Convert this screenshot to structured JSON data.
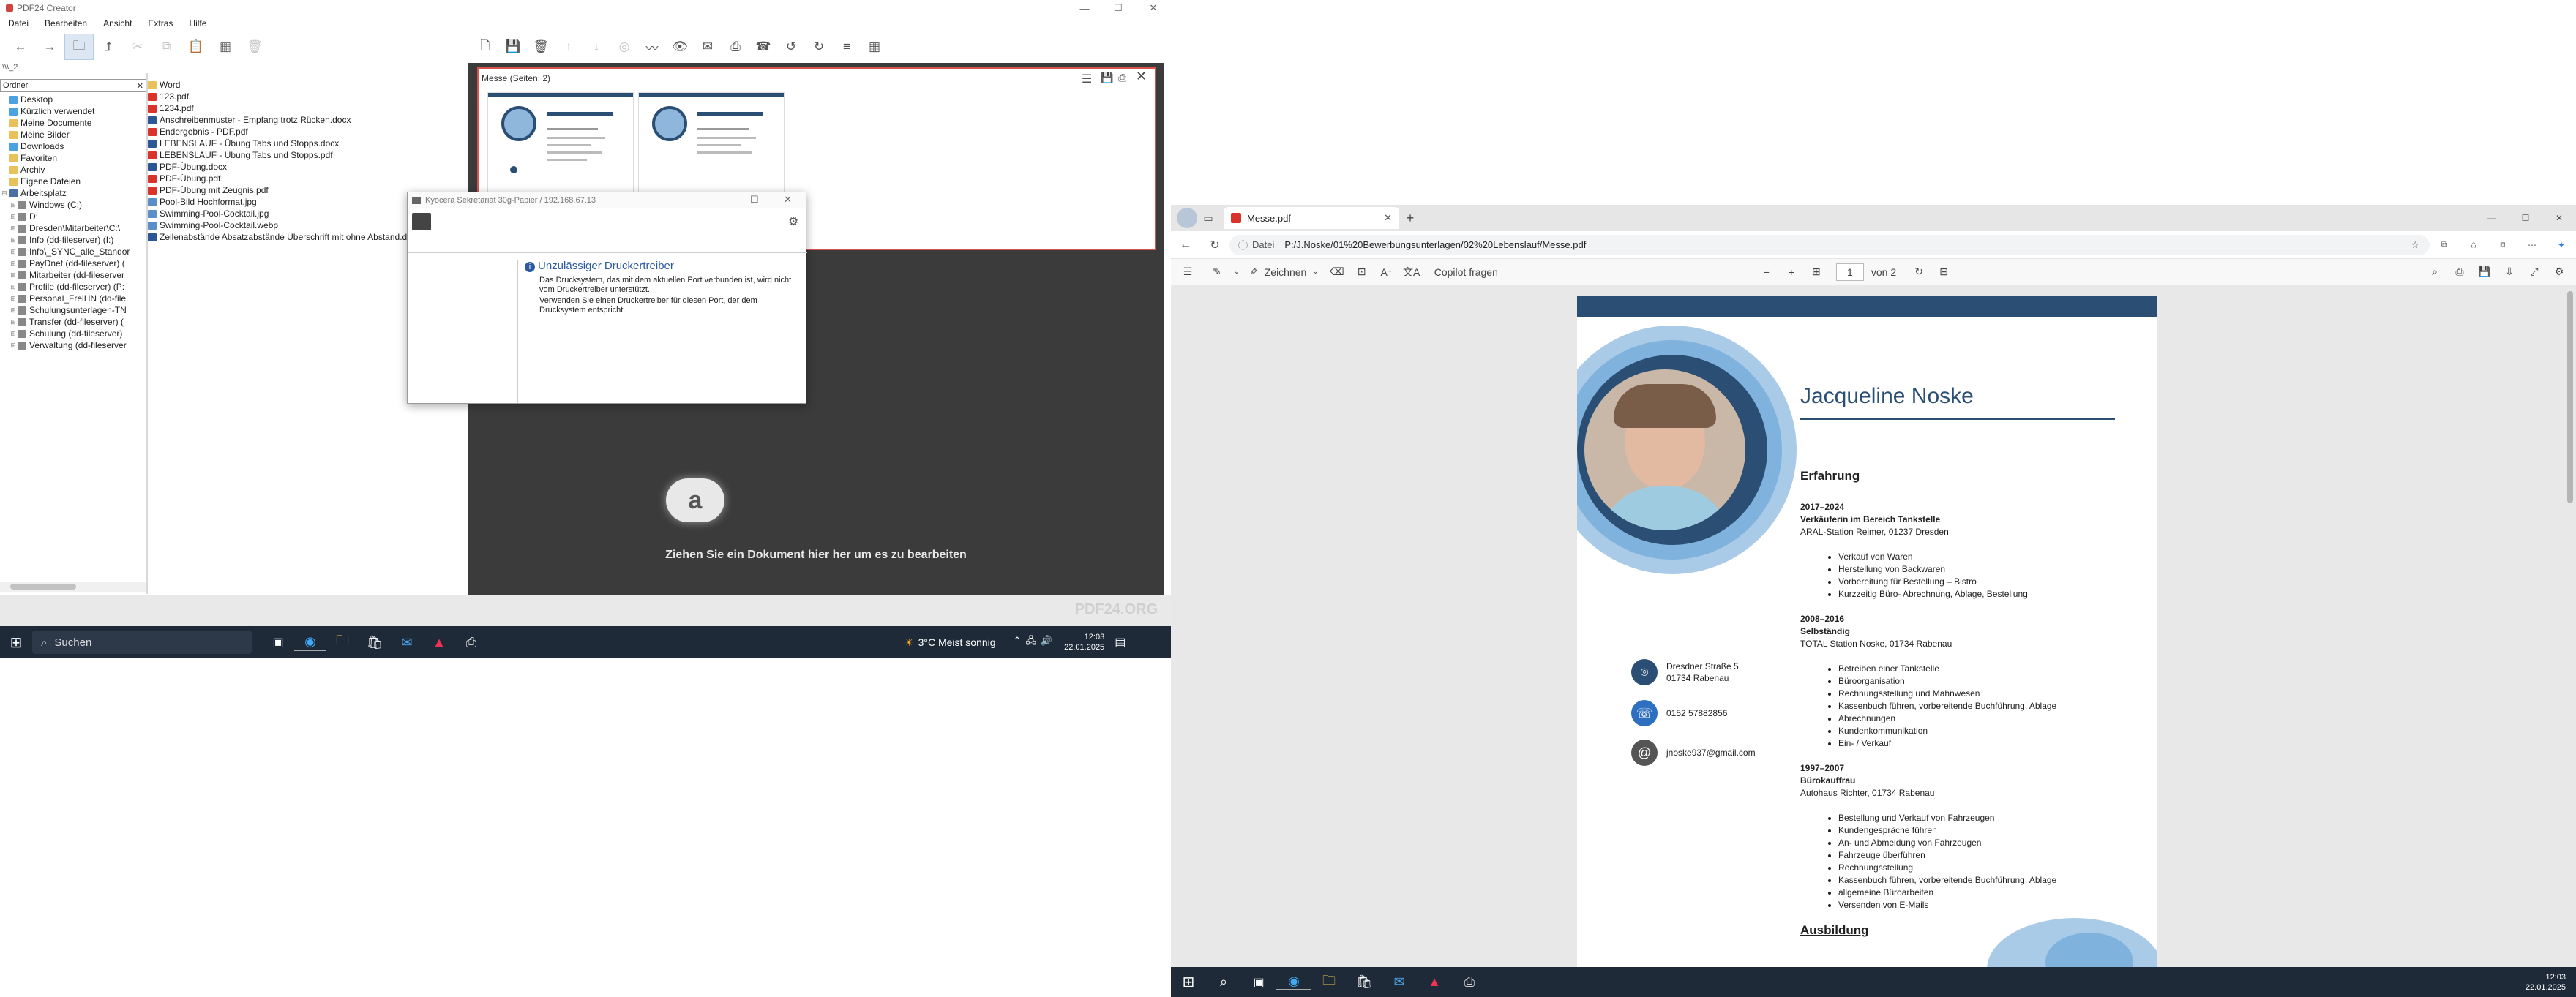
{
  "left_app": {
    "title": "PDF24 Creator",
    "menu": [
      "Datei",
      "Bearbeiten",
      "Ansicht",
      "Extras",
      "Hilfe"
    ],
    "path": "\\\\\\_2",
    "tree_header": "Ordner",
    "tree": [
      {
        "label": "Desktop",
        "color": "#4aa3df"
      },
      {
        "label": "Kürzlich verwendet",
        "color": "#4aa3df"
      },
      {
        "label": "Meine Documente",
        "color": "#e8c15a"
      },
      {
        "label": "Meine Bilder",
        "color": "#e8c15a"
      },
      {
        "label": "Downloads",
        "color": "#4aa3df"
      },
      {
        "label": "Favoriten",
        "color": "#e8c15a"
      },
      {
        "label": "Archiv",
        "color": "#e8c15a"
      },
      {
        "label": "Eigene Dateien",
        "color": "#e8c15a"
      },
      {
        "label": "Arbeitsplatz",
        "color": "#4a6fa5"
      },
      {
        "label": "Windows (C:)",
        "color": "#888"
      },
      {
        "label": "D:",
        "color": "#888"
      },
      {
        "label": "Dresden\\Mitarbeiter\\C:\\",
        "color": "#888"
      },
      {
        "label": "Info (dd-fileserver) (I:)",
        "color": "#888"
      },
      {
        "label": "Info\\_SYNC_alle_Standor",
        "color": "#888"
      },
      {
        "label": "PayDnet (dd-fileserver) (",
        "color": "#888"
      },
      {
        "label": "Mitarbeiter (dd-fileserver",
        "color": "#888"
      },
      {
        "label": "Profile (dd-fileserver) (P:",
        "color": "#888"
      },
      {
        "label": "Personal_FreiHN (dd-file",
        "color": "#888"
      },
      {
        "label": "Schulungsunterlagen-TN",
        "color": "#888"
      },
      {
        "label": "Transfer (dd-fileserver) (",
        "color": "#888"
      },
      {
        "label": "Schulung (dd-fileserver)",
        "color": "#888"
      },
      {
        "label": "Verwaltung (dd-fileserver",
        "color": "#888"
      }
    ],
    "files": [
      {
        "label": "Word",
        "color": "#e8c15a"
      },
      {
        "label": "123.pdf",
        "color": "#d9342b"
      },
      {
        "label": "1234.pdf",
        "color": "#d9342b"
      },
      {
        "label": "Anschreibenmuster - Empfang trotz Rücken.docx",
        "color": "#2b5797"
      },
      {
        "label": "Endergebnis - PDF.pdf",
        "color": "#d9342b"
      },
      {
        "label": "LEBENSLAUF - Übung Tabs und Stopps.docx",
        "color": "#2b5797"
      },
      {
        "label": "LEBENSLAUF - Übung Tabs und Stopps.pdf",
        "color": "#d9342b"
      },
      {
        "label": "PDF-Übung.docx",
        "color": "#2b5797"
      },
      {
        "label": "PDF-Übung.pdf",
        "color": "#d9342b"
      },
      {
        "label": "PDF-Übung mit Zeugnis.pdf",
        "color": "#d9342b"
      },
      {
        "label": "Pool-Bild Hochformat.jpg",
        "color": "#5a8fc7"
      },
      {
        "label": "Swimming-Pool-Cocktail.jpg",
        "color": "#5a8fc7"
      },
      {
        "label": "Swimming-Pool-Cocktail.webp",
        "color": "#5a8fc7"
      },
      {
        "label": "Zeilenabstände Absatzabstände Überschrift mit ohne Abstand.docx",
        "color": "#2b5797"
      }
    ],
    "doc_panel_title": "Messe (Seiten: 2)",
    "drop_text": "Ziehen Sie ein Dokument hier her um es zu bearbeiten",
    "watermark": "PDF24.ORG"
  },
  "dialog": {
    "title": "Kyocera Sekretariat 30g-Papier / 192.168.67.13",
    "heading": "Unzulässiger Druckertreiber",
    "line1": "Das Drucksystem, das mit dem aktuellen Port verbunden ist, wird nicht vom Druckertreiber unterstützt.",
    "line2": "Verwenden Sie einen Druckertreiber für diesen Port, der dem Drucksystem entspricht."
  },
  "taskbar_left": {
    "search": "Suchen",
    "weather": "3°C  Meist sonnig",
    "time": "12:03",
    "date": "22.01.2025"
  },
  "browser": {
    "tab_title": "Messe.pdf",
    "addr_label": "Datei",
    "url": "P:/J.Noske/01%20Bewerbungsunterlagen/02%20Lebenslauf/Messe.pdf",
    "draw_label": "Zeichnen",
    "copilot": "Copilot fragen",
    "page_num": "1",
    "page_total": "von 2"
  },
  "resume": {
    "name": "Jacqueline Noske",
    "section1": "Erfahrung",
    "job1_years": "2017–2024",
    "job1_title": "Verkäuferin im Bereich Tankstelle",
    "job1_place": "ARAL-Station Reimer, 01237 Dresden",
    "job1_items": [
      "Verkauf von Waren",
      "Herstellung von Backwaren",
      "Vorbereitung für Bestellung – Bistro",
      "Kurzzeitig Büro- Abrechnung, Ablage, Bestellung"
    ],
    "job2_years": "2008–2016",
    "job2_title": "Selbständig",
    "job2_place": "TOTAL Station Noske, 01734 Rabenau",
    "job2_items": [
      "Betreiben einer Tankstelle",
      "Büroorganisation",
      "Rechnungsstellung und Mahnwesen",
      "Kassenbuch führen, vorbereitende Buchführung, Ablage",
      "Abrechnungen",
      "Kundenkommunikation",
      "Ein- / Verkauf"
    ],
    "job3_years": "1997–2007",
    "job3_title": "Bürokauffrau",
    "job3_place": "Autohaus Richter, 01734 Rabenau",
    "job3_items": [
      "Bestellung und Verkauf von Fahrzeugen",
      "Kundengespräche führen",
      "An- und Abmeldung von Fahrzeugen",
      "Fahrzeuge überführen",
      "Rechnungsstellung",
      "Kassenbuch führen, vorbereitende Buchführung, Ablage",
      "allgemeine Büroarbeiten",
      "Versenden von E-Mails"
    ],
    "section2": "Ausbildung",
    "address1": "Dresdner Straße 5",
    "address2": "01734 Rabenau",
    "phone": "0152 57882856",
    "email": "jnoske937@gmail.com"
  },
  "taskbar_right": {
    "time": "12:03",
    "date": "22.01.2025"
  },
  "colors": {
    "accent_blue": "#2a4e74",
    "light_blue": "#7fb2dc",
    "pdf_red": "#d9342b",
    "taskbar": "#1f2a38"
  }
}
